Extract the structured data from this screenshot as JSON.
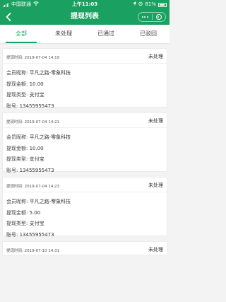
{
  "status_bar": {
    "carrier": "中国联通",
    "time": "上午11:03",
    "battery": "81%"
  },
  "nav": {
    "title": "提现列表"
  },
  "tabs": [
    {
      "label": "全部",
      "active": true
    },
    {
      "label": "未处理",
      "active": false
    },
    {
      "label": "已通过",
      "active": false
    },
    {
      "label": "已驳回",
      "active": false
    }
  ],
  "labels": {
    "time_prefix": "提现时间: ",
    "member": "会员昵称: ",
    "amount": "提现金额: ",
    "type": "提现类型: ",
    "account": "账号: "
  },
  "records": [
    {
      "time": "2019-07-04 14:19",
      "status": "未处理",
      "member": "平凡之路-零象科技",
      "amount": "10.00",
      "type": "支付宝",
      "account": "13455955473"
    },
    {
      "time": "2019-07-04 14:21",
      "status": "未处理",
      "member": "平凡之路-零象科技",
      "amount": "10.00",
      "type": "支付宝",
      "account": "13455955473"
    },
    {
      "time": "2019-07-04 14:23",
      "status": "未处理",
      "member": "平凡之路-零象科技",
      "amount": "5.00",
      "type": "支付宝",
      "account": "13455955473"
    },
    {
      "time": "2019-07-10 14:31",
      "status": "未处理"
    }
  ],
  "colors": {
    "brand": "#1aa060",
    "background": "#f3f3f3"
  }
}
